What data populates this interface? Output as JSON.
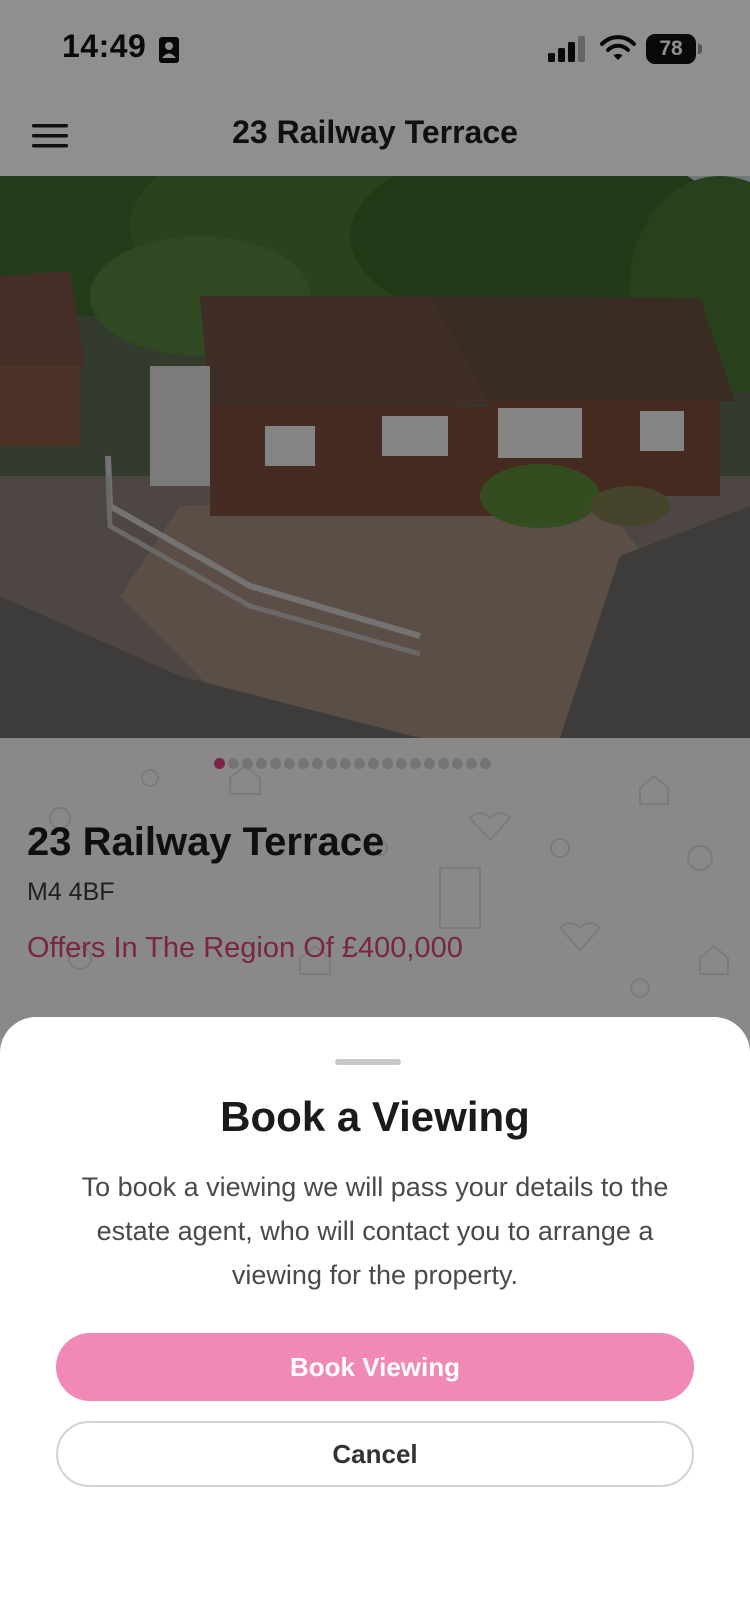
{
  "status_bar": {
    "time": "14:49",
    "battery_level": "78",
    "icons": [
      "focus-contact-icon",
      "cellular-signal-icon",
      "wifi-icon",
      "battery-icon"
    ]
  },
  "nav": {
    "title": "23 Railway Terrace",
    "menu_icon": "hamburger-menu-icon"
  },
  "gallery": {
    "image_count": 20,
    "active_index": 0
  },
  "property": {
    "title": "23 Railway Terrace",
    "postcode": "M4 4BF",
    "price": "Offers In The Region Of £400,000"
  },
  "sheet": {
    "title": "Book a Viewing",
    "description": "To book a viewing we will pass your details to the estate agent, who will contact you to arrange a viewing for the property.",
    "primary_button": "Book Viewing",
    "secondary_button": "Cancel"
  },
  "colors": {
    "accent": "#d6427e",
    "primary_button": "#f089b6",
    "overlay": "rgba(0,0,0,0.44)"
  }
}
